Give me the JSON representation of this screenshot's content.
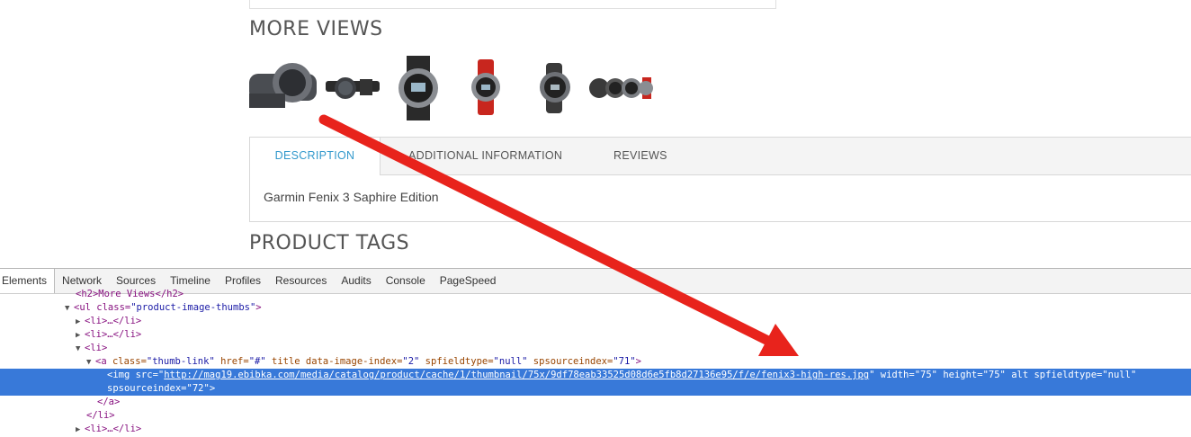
{
  "page": {
    "more_views_heading": "MORE VIEWS",
    "product_tags_heading": "PRODUCT TAGS",
    "thumbnails": [
      {
        "name": "fenix3-side-view"
      },
      {
        "name": "fenix3-with-strap"
      },
      {
        "name": "fenix3-front-view"
      },
      {
        "name": "fenix3-red-band"
      },
      {
        "name": "fenix3-angled-view"
      },
      {
        "name": "fenix3-group-view"
      }
    ],
    "tabs": [
      {
        "label": "DESCRIPTION",
        "active": true
      },
      {
        "label": "ADDITIONAL INFORMATION",
        "active": false
      },
      {
        "label": "REVIEWS",
        "active": false
      }
    ],
    "description_text": "Garmin Fenix 3 Saphire Edition",
    "accent_color": "#3399cc"
  },
  "devtools": {
    "tabs": [
      "Elements",
      "Network",
      "Sources",
      "Timeline",
      "Profiles",
      "Resources",
      "Audits",
      "Console",
      "PageSpeed"
    ],
    "active_tab": "Elements",
    "lines": {
      "l0": "<h2>More Views</h2>",
      "l1_tag_open": "<ul class=",
      "l1_val": "\"product-image-thumbs\"",
      "l1_close": ">",
      "l2": "<li>…</li>",
      "l3": "<li>…</li>",
      "l4": "<li>",
      "l5_a": "<a ",
      "l5_attr1": "class=",
      "l5_val1": "\"thumb-link\"",
      "l5_attr2": " href=",
      "l5_val2": "\"#\"",
      "l5_attr3": " title data-image-index=",
      "l5_val3": "\"2\"",
      "l5_attr4": " spfieldtype=",
      "l5_val4": "\"null\"",
      "l5_attr5": " spsourceindex=",
      "l5_val5": "\"71\"",
      "l5_close": ">",
      "l6_img": "<img ",
      "l6_attr1": "src=",
      "l6_q1": "\"",
      "l6_url": "http://mag19.ebibka.com/media/catalog/product/cache/1/thumbnail/75x/9df78eab33525d08d6e5fb8d27136e95/f/e/fenix3-high-res.jpg",
      "l6_q2": "\"",
      "l6_attr2": " width=",
      "l6_val2": "\"75\"",
      "l6_attr3": " height=",
      "l6_val3": "\"75\"",
      "l6_attr4": " alt spfieldtype=",
      "l6_val4": "\"null\"",
      "l7_attr": "spsourceindex=",
      "l7_val": "\"72\"",
      "l7_close": ">",
      "l8": "</a>",
      "l9": "</li>",
      "l10": "<li>…</li>"
    },
    "selection_color": "#3879d9"
  },
  "annotation": {
    "arrow_color": "#e8231c"
  }
}
